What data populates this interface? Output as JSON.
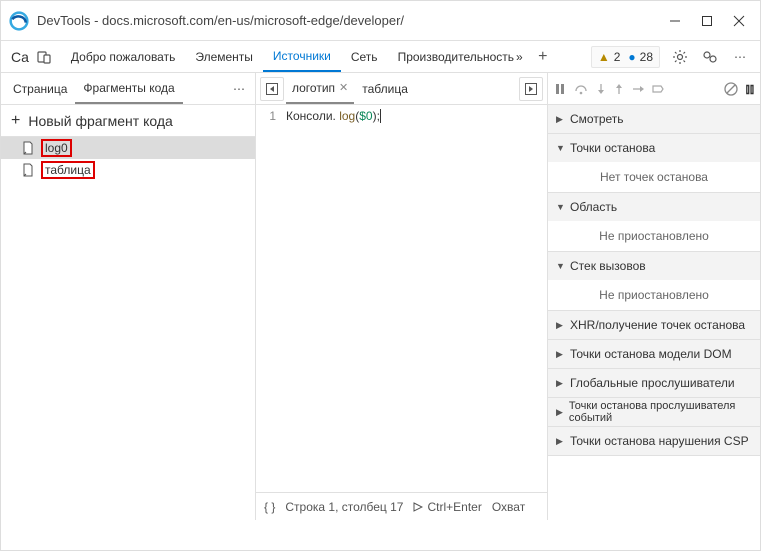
{
  "window": {
    "title": "DevTools - docs.microsoft.com/en-us/microsoft-edge/developer/"
  },
  "topbar": {
    "left_label": "Ca",
    "tabs": [
      {
        "label": "Добро пожаловать"
      },
      {
        "label": "Элементы"
      },
      {
        "label": "Источники",
        "active": true
      },
      {
        "label": "Сеть"
      },
      {
        "label": "Производительность"
      }
    ],
    "warnings": "2",
    "info": "28"
  },
  "sidebar": {
    "subtabs": [
      {
        "label": "Страница"
      },
      {
        "label": "Фрагменты кода",
        "active": true
      }
    ],
    "new_label": "Новый фрагмент кода",
    "items": [
      {
        "label": "log0",
        "selected": true,
        "highlight": true
      },
      {
        "label": "таблица",
        "highlight": true
      }
    ]
  },
  "editor": {
    "tabs": [
      {
        "label": "логотип",
        "active": true
      },
      {
        "label": "таблица"
      }
    ],
    "line_no": "1",
    "code_prefix": "Консоли.",
    "code_fn": "log",
    "code_arg": "$0",
    "status_pos": "Строка 1, столбец 17",
    "status_run": "Ctrl+Enter",
    "status_cov": "Охват"
  },
  "debugger": {
    "panels": [
      {
        "label": "Смотреть",
        "expanded": false
      },
      {
        "label": "Точки останова",
        "expanded": true,
        "body": "Нет точек останова"
      },
      {
        "label": "Область",
        "expanded": true,
        "body": "Не приостановлено"
      },
      {
        "label": "Стек вызовов",
        "expanded": true,
        "body": "Не приостановлено"
      },
      {
        "label": "XHR/получение точек останова",
        "expanded": false
      },
      {
        "label": "Точки останова модели DOM",
        "expanded": false
      },
      {
        "label": "Глобальные прослушиватели",
        "expanded": false
      },
      {
        "label": "Точки останова прослушивателя событий",
        "expanded": false
      },
      {
        "label": "Точки останова нарушения CSP",
        "expanded": false
      }
    ]
  }
}
